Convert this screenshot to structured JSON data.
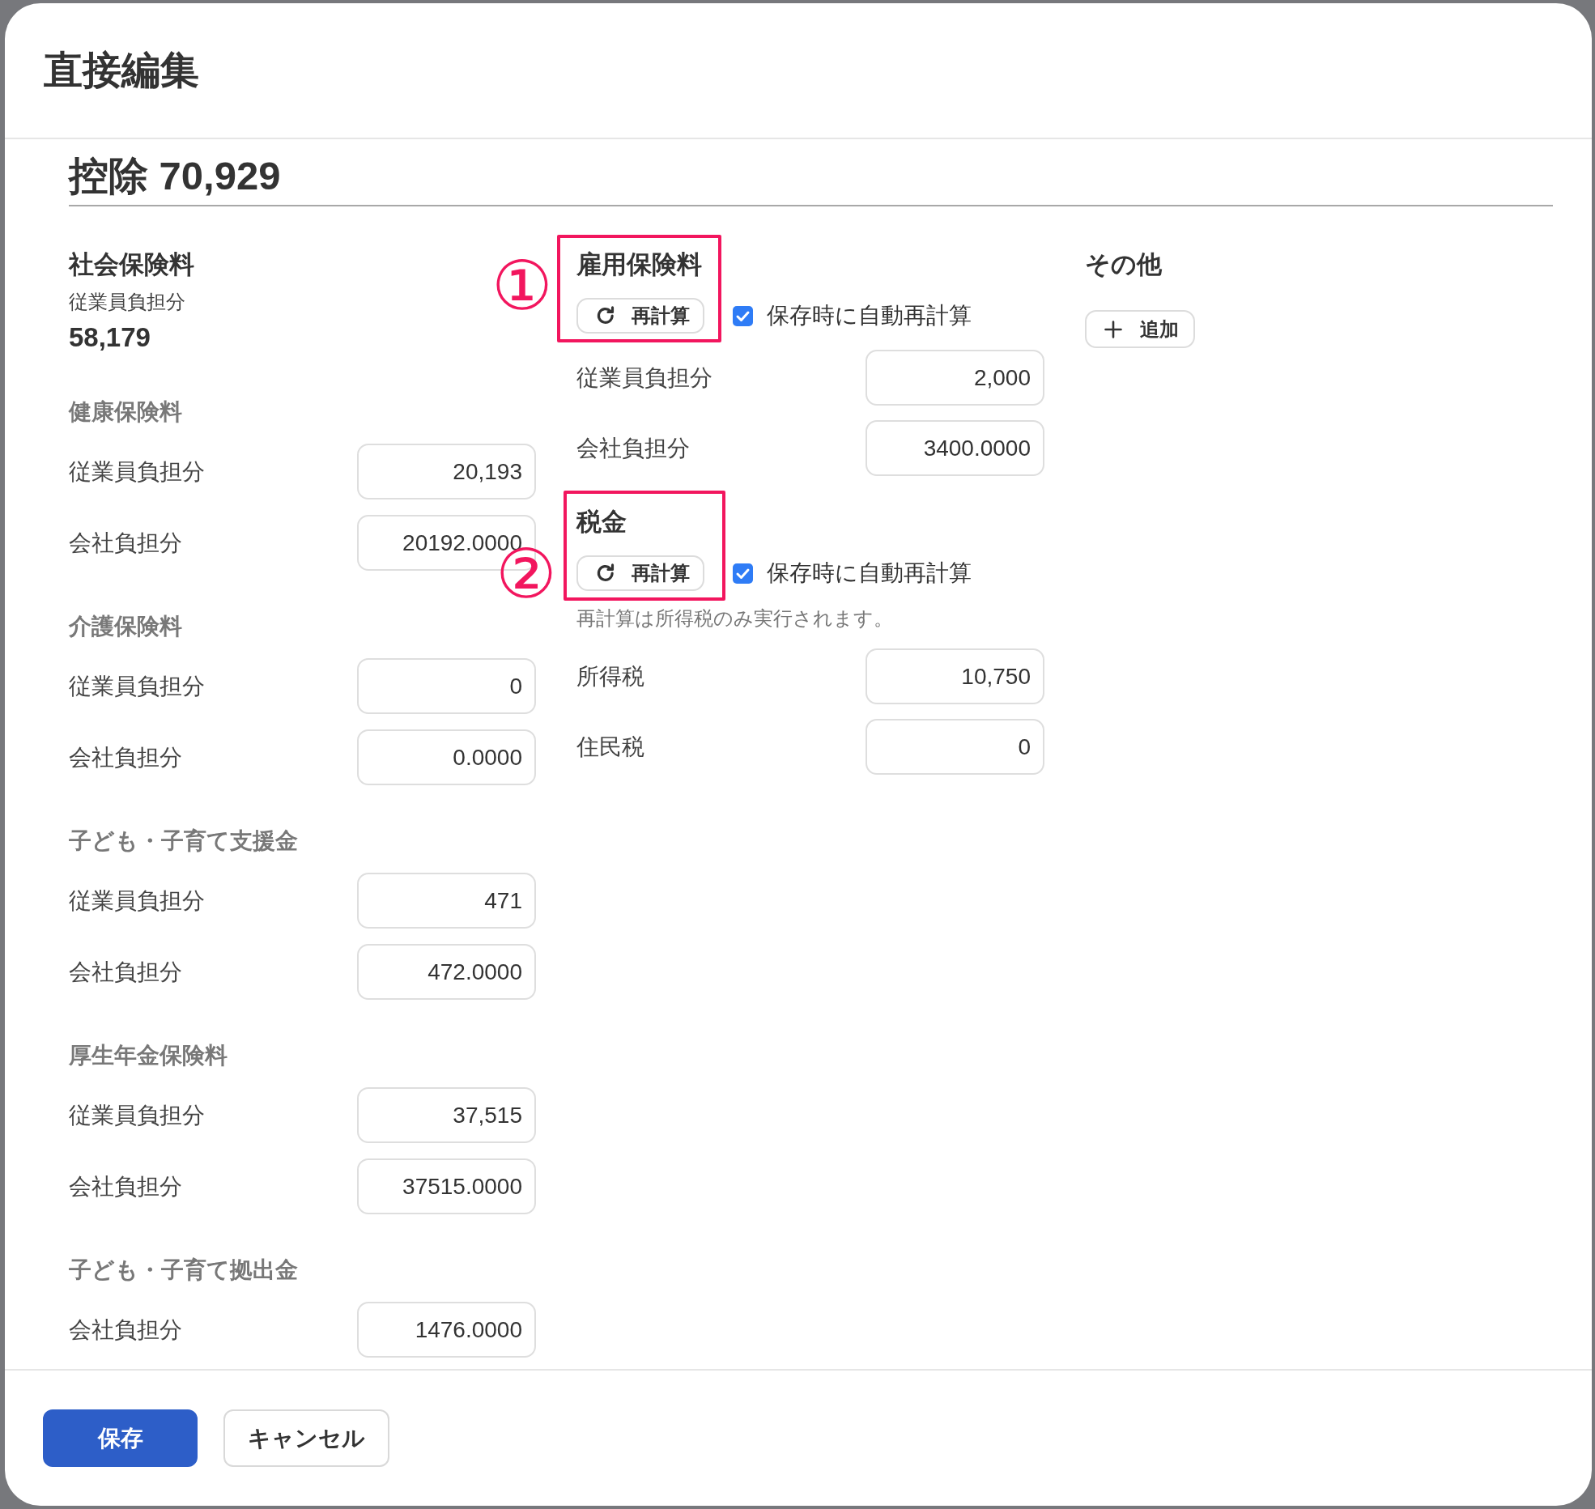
{
  "dialog": {
    "title": "直接編集"
  },
  "summary": {
    "title": "控除 70,929"
  },
  "social_insurance": {
    "title": "社会保険料",
    "subtitle": "従業員負担分",
    "total": "58,179",
    "groups": [
      {
        "title": "健康保険料",
        "fields": [
          {
            "label": "従業員負担分",
            "value": "20,193"
          },
          {
            "label": "会社負担分",
            "value": "20192.0000"
          }
        ]
      },
      {
        "title": "介護保険料",
        "fields": [
          {
            "label": "従業員負担分",
            "value": "0"
          },
          {
            "label": "会社負担分",
            "value": "0.0000"
          }
        ]
      },
      {
        "title": "子ども・子育て支援金",
        "fields": [
          {
            "label": "従業員負担分",
            "value": "471"
          },
          {
            "label": "会社負担分",
            "value": "472.0000"
          }
        ]
      },
      {
        "title": "厚生年金保険料",
        "fields": [
          {
            "label": "従業員負担分",
            "value": "37,515"
          },
          {
            "label": "会社負担分",
            "value": "37515.0000"
          }
        ]
      },
      {
        "title": "子ども・子育て拠出金",
        "fields": [
          {
            "label": "会社負担分",
            "value": "1476.0000"
          }
        ]
      }
    ]
  },
  "recalc_sections": [
    {
      "title": "雇用保険料",
      "highlighted": true,
      "marker": "①",
      "recalc_button": {
        "label": "再計算"
      },
      "auto_recalc": {
        "label": "保存時に自動再計算",
        "checked": true
      },
      "fields": [
        {
          "label": "従業員負担分",
          "value": "2,000"
        },
        {
          "label": "会社負担分",
          "value": "3400.0000"
        }
      ]
    },
    {
      "title": "税金",
      "highlighted": true,
      "marker": "②",
      "recalc_button": {
        "label": "再計算"
      },
      "auto_recalc": {
        "label": "保存時に自動再計算",
        "checked": true
      },
      "note": "再計算は所得税のみ実行されます。",
      "fields": [
        {
          "label": "所得税",
          "value": "10,750"
        },
        {
          "label": "住民税",
          "value": "0"
        }
      ]
    }
  ],
  "other": {
    "title": "その他",
    "add_button": {
      "label": "追加"
    }
  },
  "footer": {
    "buttons": [
      {
        "label": "保存",
        "kind": "primary"
      },
      {
        "label": "キャンセル",
        "kind": "secondary"
      }
    ]
  }
}
